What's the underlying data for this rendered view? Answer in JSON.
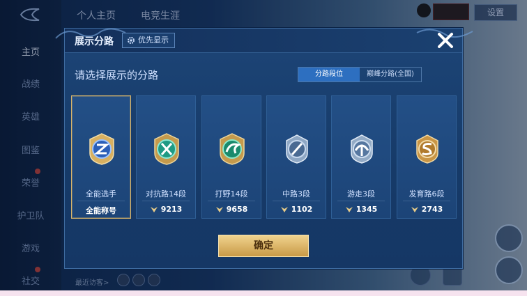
{
  "leftnav": {
    "items": [
      {
        "label": "主页",
        "active": true
      },
      {
        "label": "战绩"
      },
      {
        "label": "英雄"
      },
      {
        "label": "图鉴"
      },
      {
        "label": "荣誉"
      },
      {
        "label": "护卫队"
      },
      {
        "label": "游戏"
      },
      {
        "label": "社交"
      }
    ]
  },
  "top_tabs": [
    "个人主页",
    "电竞生涯"
  ],
  "top_right": {
    "settings_label": "设置"
  },
  "visitors": {
    "label": "最近访客>"
  },
  "dialog": {
    "title": "展示分路",
    "priority_label": "优先显示",
    "prompt": "请选择展示的分路",
    "segments": [
      "分路段位",
      "巅峰分路(全国)"
    ],
    "active_segment": 0,
    "cards": [
      {
        "name": "全能选手",
        "score": "全能称号",
        "selected": true,
        "emblem": "all-round-emblem-icon",
        "color": "#4a86d8"
      },
      {
        "name": "对抗路14段",
        "score": "9213",
        "emblem": "clash-lane-emblem-icon",
        "color": "#2fb39b"
      },
      {
        "name": "打野14段",
        "score": "9658",
        "emblem": "jungle-emblem-icon",
        "color": "#29a37f"
      },
      {
        "name": "中路3段",
        "score": "1102",
        "emblem": "mid-lane-emblem-icon",
        "color": "#6f8fb4"
      },
      {
        "name": "游走3段",
        "score": "1345",
        "emblem": "roam-emblem-icon",
        "color": "#7f9dc0"
      },
      {
        "name": "发育路6段",
        "score": "2743",
        "emblem": "farm-lane-emblem-icon",
        "color": "#c79a4a"
      }
    ],
    "confirm_label": "确定"
  },
  "colors": {
    "accent_gold": "#d9b56a",
    "segment_active": "#2d6fc0"
  }
}
